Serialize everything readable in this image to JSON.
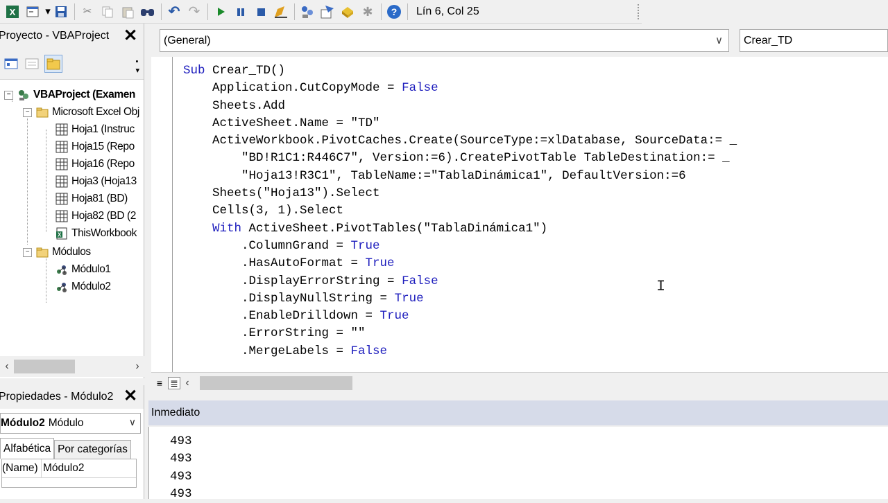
{
  "toolbar": {
    "position_label": "Lín 6, Col 25",
    "buttons": [
      "excel-icon",
      "insert-userform-icon",
      "save-icon",
      "cut-icon",
      "copy-icon",
      "paste-icon",
      "find-icon",
      "undo-icon",
      "redo-icon",
      "run-icon",
      "break-icon",
      "reset-icon",
      "design-mode-icon",
      "project-explorer-icon",
      "properties-icon",
      "object-browser-icon",
      "toolbox-icon",
      "help-icon"
    ]
  },
  "project_pane": {
    "title": "Proyecto - VBAProject",
    "close": "✕",
    "tree": {
      "root": "VBAProject (Examen",
      "excel_objects": "Microsoft Excel Obj",
      "sheets": [
        "Hoja1 (Instruc",
        "Hoja15 (Repo",
        "Hoja16 (Repo",
        "Hoja3 (Hoja13",
        "Hoja81 (BD)",
        "Hoja82 (BD (2",
        "ThisWorkbook"
      ],
      "modules_folder": "Módulos",
      "modules": [
        "Módulo1",
        "Módulo2"
      ]
    }
  },
  "properties_pane": {
    "title": "Propiedades - Módulo2",
    "close": "✕",
    "object_name": "Módulo2",
    "object_type": "Módulo",
    "tabs": [
      "Alfabética",
      "Por categorías"
    ],
    "rows": [
      {
        "key": "(Name)",
        "value": "Módulo2"
      }
    ]
  },
  "code_window": {
    "object_combo": "(General)",
    "procedure_combo": "Crear_TD",
    "lines": [
      [
        {
          "t": "Sub ",
          "k": 1
        },
        {
          "t": "Crear_TD()"
        }
      ],
      [
        {
          "t": "    Application.CutCopyMode = "
        },
        {
          "t": "False",
          "k": 1
        }
      ],
      [
        {
          "t": "    Sheets.Add"
        }
      ],
      [
        {
          "t": "    ActiveSheet.Name = \"TD\""
        }
      ],
      [
        {
          "t": "    ActiveWorkbook.PivotCaches.Create(SourceType:=xlDatabase, SourceData:= _"
        }
      ],
      [
        {
          "t": "        \"BD!R1C1:R446C7\", Version:=6).CreatePivotTable TableDestination:= _"
        }
      ],
      [
        {
          "t": "        \"Hoja13!R3C1\", TableName:=\"TablaDinámica1\", DefaultVersion:=6"
        }
      ],
      [
        {
          "t": "    Sheets(\"Hoja13\").Select"
        }
      ],
      [
        {
          "t": "    Cells(3, 1).Select"
        }
      ],
      [
        {
          "t": "    With ",
          "k": 1
        },
        {
          "t": "ActiveSheet.PivotTables(\"TablaDinámica1\")"
        }
      ],
      [
        {
          "t": "        .ColumnGrand = "
        },
        {
          "t": "True",
          "k": 1
        }
      ],
      [
        {
          "t": "        .HasAutoFormat = "
        },
        {
          "t": "True",
          "k": 1
        }
      ],
      [
        {
          "t": "        .DisplayErrorString = "
        },
        {
          "t": "False",
          "k": 1
        }
      ],
      [
        {
          "t": "        .DisplayNullString = "
        },
        {
          "t": "True",
          "k": 1
        }
      ],
      [
        {
          "t": "        .EnableDrilldown = "
        },
        {
          "t": "True",
          "k": 1
        }
      ],
      [
        {
          "t": "        .ErrorString = \"\""
        }
      ],
      [
        {
          "t": "        .MergeLabels = "
        },
        {
          "t": "False",
          "k": 1
        }
      ]
    ]
  },
  "immediate_window": {
    "title": "Inmediato",
    "lines": [
      "493",
      "493",
      "493",
      "493"
    ]
  }
}
